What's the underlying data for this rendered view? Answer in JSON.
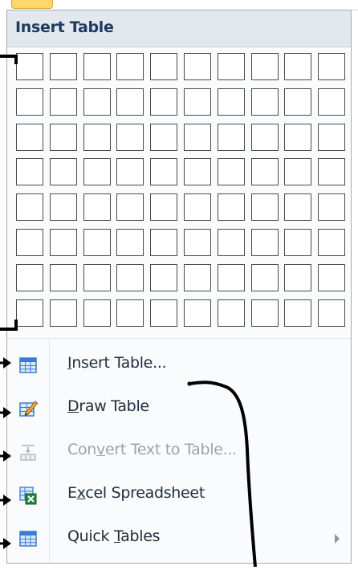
{
  "menu": {
    "header": "Insert Table",
    "grid": {
      "rows": 8,
      "cols": 10
    },
    "items": [
      {
        "label_pre": "",
        "label_u": "I",
        "label_post": "nsert Table...",
        "icon": "table-grid-icon",
        "disabled": false,
        "submenu": false
      },
      {
        "label_pre": "",
        "label_u": "D",
        "label_post": "raw Table",
        "icon": "pencil-table-icon",
        "disabled": false,
        "submenu": false
      },
      {
        "label_pre": "Con",
        "label_u": "v",
        "label_post": "ert Text to Table...",
        "icon": "convert-text-icon",
        "disabled": true,
        "submenu": false
      },
      {
        "label_pre": "E",
        "label_u": "x",
        "label_post": "cel Spreadsheet",
        "icon": "excel-icon",
        "disabled": false,
        "submenu": false
      },
      {
        "label_pre": "Quick ",
        "label_u": "T",
        "label_post": "ables",
        "icon": "quick-tables-icon",
        "disabled": false,
        "submenu": true
      }
    ]
  },
  "colors": {
    "header_text": "#1e3a5f",
    "grid_border": "#4a4a4a",
    "disabled_text": "#9aa3ad",
    "accent_blue": "#3a7bd5",
    "excel_green": "#1e8b3a"
  }
}
